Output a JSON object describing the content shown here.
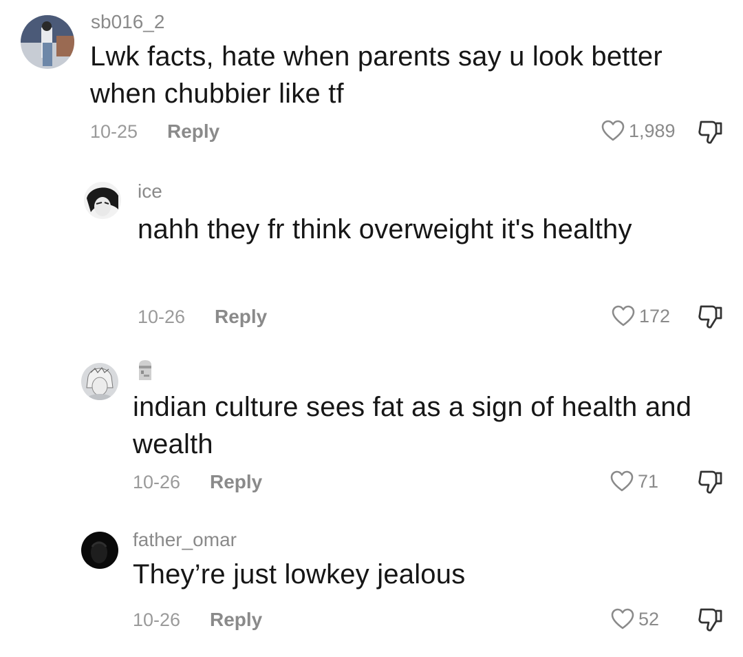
{
  "comments": [
    {
      "username": "sb016_2",
      "text": "Lwk facts, hate when parents say u look better when chubbier like tf",
      "date": "10-25",
      "reply_label": "Reply",
      "likes": "1,989"
    },
    {
      "username": "ice",
      "text": "nahh they fr think overweight it's healthy",
      "date": "10-26",
      "reply_label": "Reply",
      "likes": "172"
    },
    {
      "username": "",
      "username_icon": "moai-emoji",
      "text": "indian culture sees fat as a sign of health and wealth",
      "date": "10-26",
      "reply_label": "Reply",
      "likes": "71"
    },
    {
      "username": "father_omar",
      "text": "They’re just lowkey jealous",
      "date": "10-26",
      "reply_label": "Reply",
      "likes": "52"
    }
  ],
  "icons": {
    "like": "heart-outline-icon",
    "dislike": "thumbs-down-icon"
  },
  "colors": {
    "text": "#161616",
    "muted": "#8a8a8a",
    "background": "#ffffff"
  }
}
